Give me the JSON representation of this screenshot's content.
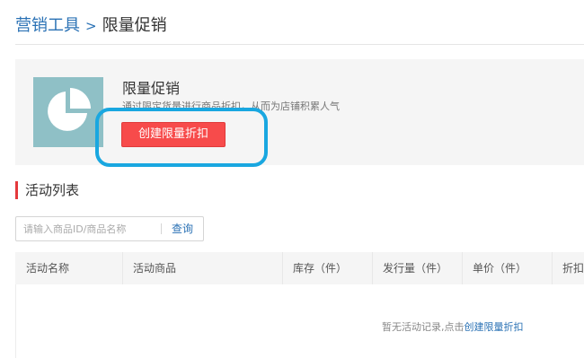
{
  "breadcrumb": {
    "parent": "营销工具",
    "separator": ">",
    "current": "限量促销"
  },
  "intro": {
    "title": "限量促销",
    "description": "通过限定货量进行商品折扣，从而为店铺积累人气",
    "create_button": "创建限量折扣",
    "icon": "pie-chart-icon"
  },
  "activity_section": {
    "title": "活动列表"
  },
  "search": {
    "placeholder": "请输入商品ID/商品名称",
    "button": "查询"
  },
  "table": {
    "columns": [
      "活动名称",
      "活动商品",
      "库存（件）",
      "发行量（件）",
      "单价（件）",
      "折扣"
    ],
    "empty_text": "暂无活动记录,点击",
    "empty_link": "创建限量折扣"
  },
  "colors": {
    "accent_blue": "#2b72b5",
    "create_button_red": "#f74b4b",
    "icon_tile": "#8fc0c6",
    "highlight_ring": "#19a7e0",
    "section_marker": "#e4393c"
  }
}
